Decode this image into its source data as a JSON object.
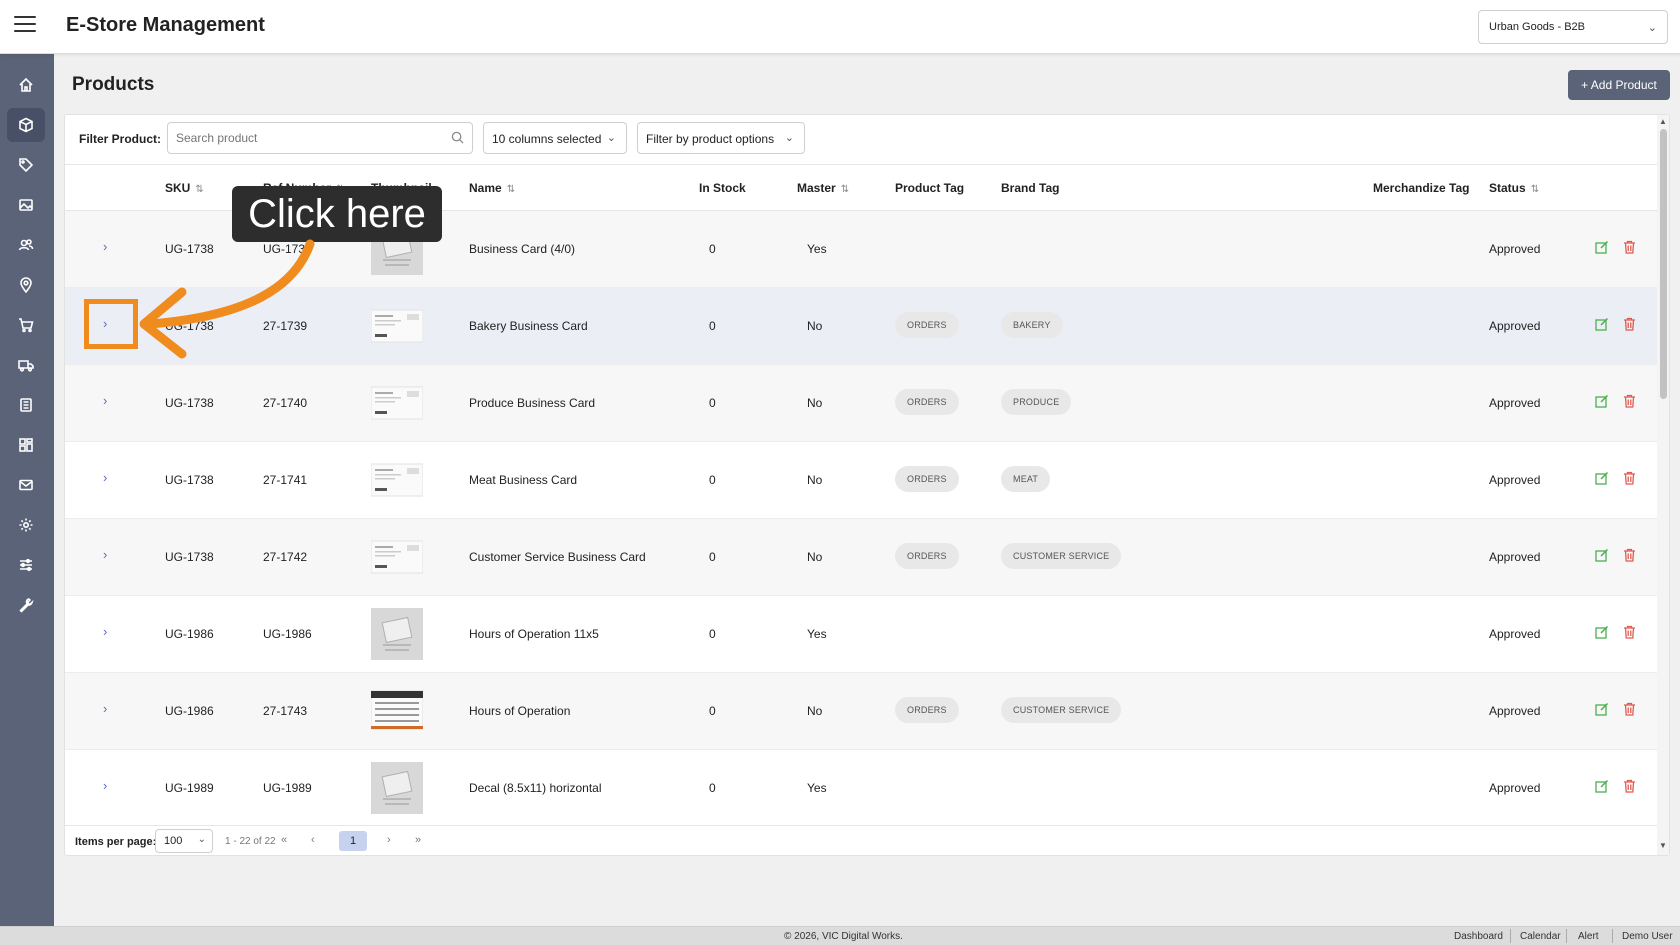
{
  "header": {
    "title": "E-Store Management",
    "store_selector": "Urban Goods - B2B"
  },
  "sidebar": {
    "items": [
      {
        "icon": "home-icon"
      },
      {
        "icon": "box-icon",
        "active": true
      },
      {
        "icon": "tag-icon"
      },
      {
        "icon": "image-icon"
      },
      {
        "icon": "users-icon"
      },
      {
        "icon": "location-pin-icon"
      },
      {
        "icon": "cart-icon"
      },
      {
        "icon": "truck-icon"
      },
      {
        "icon": "document-icon"
      },
      {
        "icon": "grid-icon"
      },
      {
        "icon": "mail-icon"
      },
      {
        "icon": "gear-icon"
      },
      {
        "icon": "sliders-icon"
      },
      {
        "icon": "wrench-icon"
      }
    ]
  },
  "page": {
    "title": "Products",
    "add_button": "+ Add Product"
  },
  "filter": {
    "label": "Filter Product:",
    "search_placeholder": "Search product",
    "columns_dropdown": "10 columns selected",
    "options_dropdown": "Filter by product options"
  },
  "table": {
    "headers": {
      "sku": "SKU",
      "ref": "Ref Number",
      "thumbnail": "Thumbnail",
      "name": "Name",
      "in_stock": "In Stock",
      "master": "Master",
      "product_tag": "Product Tag",
      "brand_tag": "Brand Tag",
      "merchandize_tag": "Merchandize Tag",
      "status": "Status"
    },
    "rows": [
      {
        "sku": "UG-1738",
        "ref": "UG-1738",
        "name": "Business Card (4/0)",
        "in_stock": "0",
        "master": "Yes",
        "product_tag": "",
        "brand_tag": "",
        "status": "Approved",
        "thumb": "no-image"
      },
      {
        "sku": "UG-1738",
        "ref": "27-1739",
        "name": "Bakery Business Card",
        "in_stock": "0",
        "master": "No",
        "product_tag": "ORDERS",
        "brand_tag": "BAKERY",
        "status": "Approved",
        "thumb": "card"
      },
      {
        "sku": "UG-1738",
        "ref": "27-1740",
        "name": "Produce Business Card",
        "in_stock": "0",
        "master": "No",
        "product_tag": "ORDERS",
        "brand_tag": "PRODUCE",
        "status": "Approved",
        "thumb": "card"
      },
      {
        "sku": "UG-1738",
        "ref": "27-1741",
        "name": "Meat Business Card",
        "in_stock": "0",
        "master": "No",
        "product_tag": "ORDERS",
        "brand_tag": "MEAT",
        "status": "Approved",
        "thumb": "card"
      },
      {
        "sku": "UG-1738",
        "ref": "27-1742",
        "name": "Customer Service Business Card",
        "in_stock": "0",
        "master": "No",
        "product_tag": "ORDERS",
        "brand_tag": "CUSTOMER SERVICE",
        "status": "Approved",
        "thumb": "card"
      },
      {
        "sku": "UG-1986",
        "ref": "UG-1986",
        "name": "Hours of Operation 11x5",
        "in_stock": "0",
        "master": "Yes",
        "product_tag": "",
        "brand_tag": "",
        "status": "Approved",
        "thumb": "no-image"
      },
      {
        "sku": "UG-1986",
        "ref": "27-1743",
        "name": "Hours of Operation",
        "in_stock": "0",
        "master": "No",
        "product_tag": "ORDERS",
        "brand_tag": "CUSTOMER SERVICE",
        "status": "Approved",
        "thumb": "hours"
      },
      {
        "sku": "UG-1989",
        "ref": "UG-1989",
        "name": "Decal (8.5x11) horizontal",
        "in_stock": "0",
        "master": "Yes",
        "product_tag": "",
        "brand_tag": "",
        "status": "Approved",
        "thumb": "no-image"
      }
    ]
  },
  "pager": {
    "label": "Items per page:",
    "per_page": "100",
    "range": "1 - 22 of 22",
    "current_page": "1"
  },
  "footer": {
    "copyright": "© 2026, VIC Digital Works.",
    "links": [
      "Dashboard",
      "Calendar",
      "Alert",
      "Demo User"
    ]
  },
  "overlay": {
    "callout": "Click here"
  },
  "colors": {
    "sidebar": "#5a6378",
    "accent_orange": "#f08c1e",
    "edit_green": "#4caf50",
    "delete_red": "#e05a4f"
  }
}
